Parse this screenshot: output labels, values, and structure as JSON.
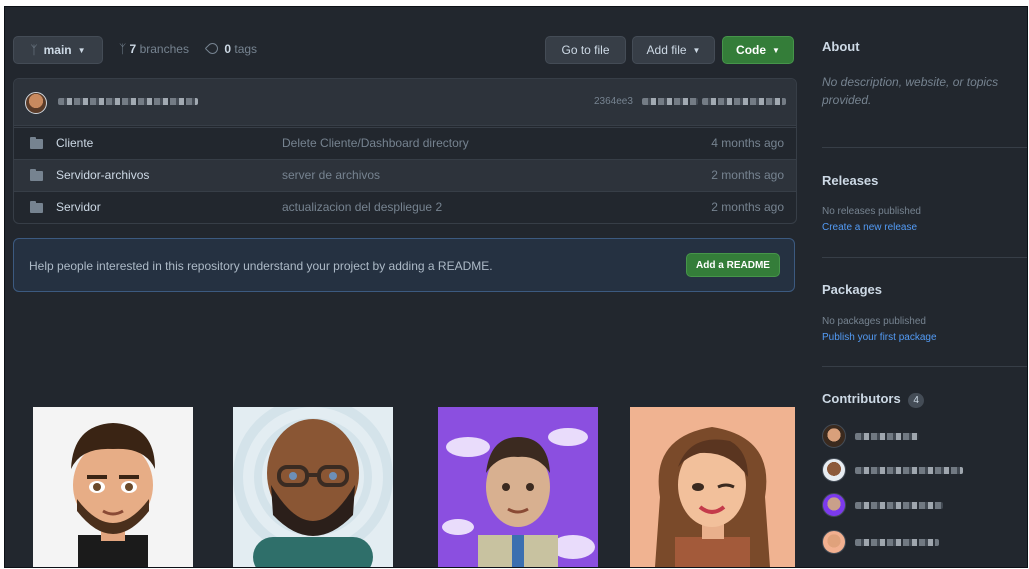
{
  "branch": {
    "name": "main",
    "branches_count": "7",
    "branches_label": "branches",
    "tags_count": "0",
    "tags_label": "tags"
  },
  "toolbar": {
    "go_to_file": "Go to file",
    "add_file": "Add file",
    "code": "Code"
  },
  "commit": {
    "hash": "2364ee3"
  },
  "files": [
    {
      "name": "Cliente",
      "message": "Delete Cliente/Dashboard directory",
      "age": "4 months ago"
    },
    {
      "name": "Servidor-archivos",
      "message": "server de archivos",
      "age": "2 months ago"
    },
    {
      "name": "Servidor",
      "message": "actualizacion del despliegue 2",
      "age": "2 months ago"
    }
  ],
  "readme": {
    "text": "Help people interested in this repository understand your project by adding a README.",
    "button": "Add a README"
  },
  "sidebar": {
    "about": {
      "title": "About",
      "description": "No description, website, or topics provided."
    },
    "releases": {
      "title": "Releases",
      "none": "No releases published",
      "link": "Create a new release"
    },
    "packages": {
      "title": "Packages",
      "none": "No packages published",
      "link": "Publish your first package"
    },
    "contributors": {
      "title": "Contributors",
      "count": "4"
    }
  },
  "colors": {
    "background": "#22272e",
    "accent_green": "#347d39",
    "link_blue": "#539bf5",
    "muted": "#768390"
  }
}
